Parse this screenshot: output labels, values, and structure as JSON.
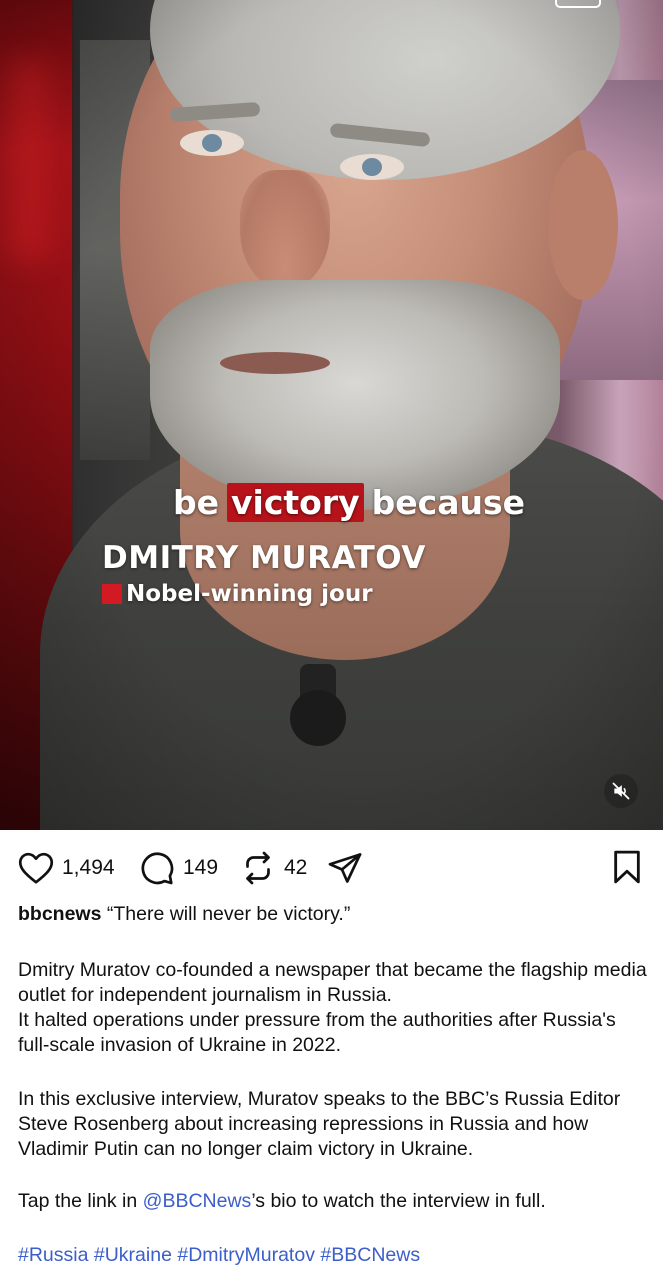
{
  "video": {
    "caption_before": "be",
    "caption_highlight": "victory",
    "caption_after": "because",
    "lower_third_name": "DMITRY MURATOV",
    "lower_third_title": "Nobel-winning jour",
    "mute_icon": "speaker-muted-icon"
  },
  "actions": {
    "likes": "1,494",
    "comments": "149",
    "reposts": "42",
    "icons": [
      "heart-icon",
      "comment-icon",
      "repost-icon",
      "share-icon",
      "bookmark-icon"
    ]
  },
  "post": {
    "username": "bbcnews",
    "headline": "“There will never be victory.”",
    "paragraph1": "Dmitry Muratov co-founded a newspaper that became the flagship media outlet for independent journalism in Russia.",
    "paragraph1b": "It halted operations under pressure from the authorities after Russia's full-scale invasion of Ukraine in 2022.",
    "paragraph2": "In this exclusive interview, Muratov speaks to the BBC’s Russia Editor Steve Rosenberg about increasing repressions in Russia and how Vladimir Putin can no longer claim victory in Ukraine.",
    "tap_prefix": "Tap the link in ",
    "mention": "@BBCNews",
    "tap_suffix": "’s bio to watch the interview in full.",
    "hashtags": [
      "#Russia",
      "#Ukraine",
      "#DmitryMuratov",
      "#BBCNews"
    ]
  },
  "colors": {
    "link": "#3b5ec9",
    "caption_highlight": "#b8131a",
    "lower_third_square": "#d11a21"
  }
}
